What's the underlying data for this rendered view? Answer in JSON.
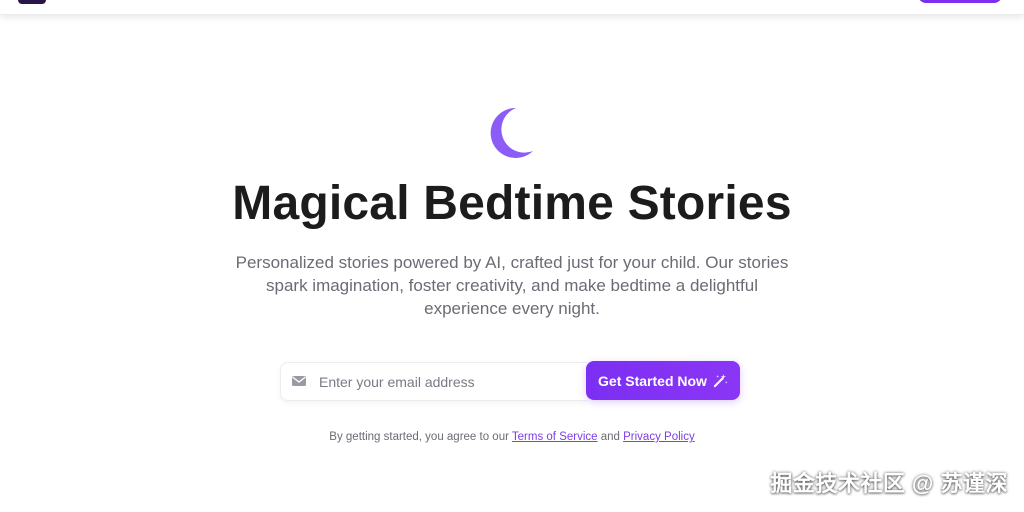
{
  "hero": {
    "icon": "moon-icon",
    "title": "Magical Bedtime Stories",
    "subtitle": "Personalized stories powered by AI, crafted just for your child. Our stories spark imagination, foster creativity, and make bedtime a delightful experience every night."
  },
  "signup": {
    "email_placeholder": "Enter your email address",
    "email_value": "",
    "mail_icon": "envelope-icon",
    "cta_label": "Get Started Now",
    "cta_icon": "magic-wand-icon"
  },
  "legal": {
    "prefix": "By getting started, you agree to our ",
    "terms_label": "Terms of Service",
    "joiner": " and ",
    "privacy_label": "Privacy Policy"
  },
  "watermark": "掘金技术社区 @ 苏谨深",
  "colors": {
    "accent": "#7b2ff2",
    "moon": "#8b5cf6",
    "title": "#1c1c1c",
    "muted": "#6b6b75"
  }
}
